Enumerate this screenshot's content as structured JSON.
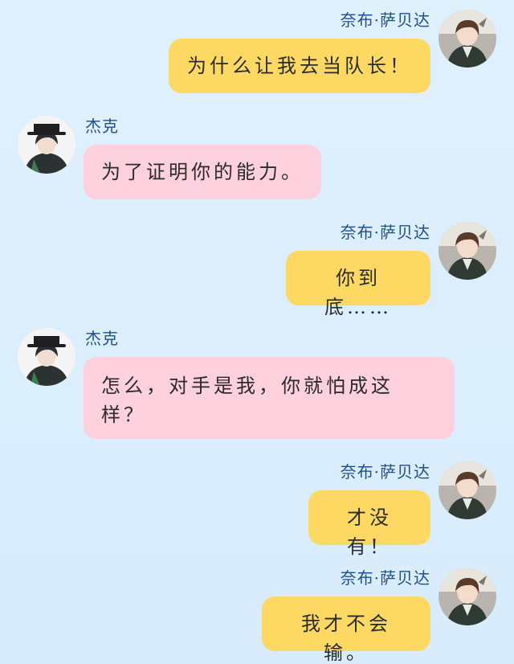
{
  "characters": {
    "nabu": {
      "name": "奈布·萨贝达",
      "avatar_icon": "nabu-avatar-icon"
    },
    "jack": {
      "name": "杰克",
      "avatar_icon": "jack-avatar-icon"
    }
  },
  "colors": {
    "background": "#dcefff",
    "right_bubble": "#fdd964",
    "left_bubble": "#fdd0dd",
    "name_text": "#1f4f8f"
  },
  "messages": [
    {
      "side": "right",
      "name": "奈布·萨贝达",
      "text": "为什么让我去当队长！"
    },
    {
      "side": "left",
      "name": "杰克",
      "text": "为了证明你的能力。"
    },
    {
      "side": "right",
      "name": "奈布·萨贝达",
      "text": "你到底……"
    },
    {
      "side": "left",
      "name": "杰克",
      "text": "怎么，对手是我，你就怕成这样？"
    },
    {
      "side": "right",
      "name": "奈布·萨贝达",
      "text": "才没有！"
    },
    {
      "side": "right",
      "name": "奈布·萨贝达",
      "text": "我才不会输。"
    }
  ]
}
